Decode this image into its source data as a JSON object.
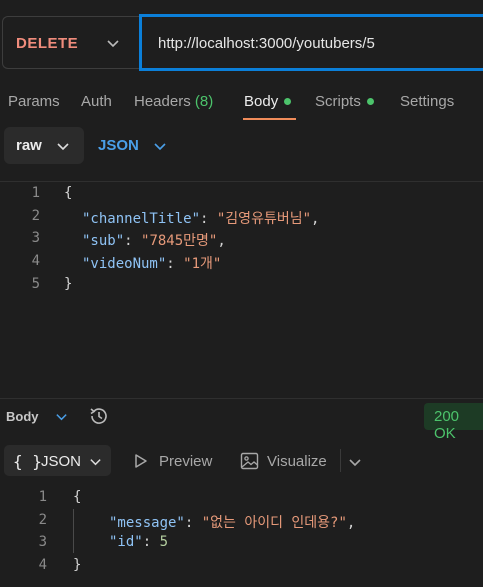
{
  "request": {
    "method": "DELETE",
    "url": "http://localhost:3000/youtubers/5"
  },
  "tabs": [
    {
      "label": "Params"
    },
    {
      "label": "Auth"
    },
    {
      "label": "Headers",
      "count": "(8)"
    },
    {
      "label": "Body",
      "active": true,
      "dot": true
    },
    {
      "label": "Scripts",
      "dot": true
    },
    {
      "label": "Settings"
    }
  ],
  "body_mode": {
    "mode": "raw",
    "format": "JSON"
  },
  "request_body": {
    "line_numbers": [
      "1",
      "2",
      "3",
      "4",
      "5"
    ],
    "open": "{",
    "close": "}",
    "fields": [
      {
        "key": "\"channelTitle\"",
        "value": "\"김영유튜버님\""
      },
      {
        "key": "\"sub\"",
        "value": "\"7845만명\""
      },
      {
        "key": "\"videoNum\"",
        "value": "\"1개\""
      }
    ]
  },
  "response": {
    "label": "Body",
    "status": "200 OK",
    "view": "JSON",
    "preview_label": "Preview",
    "visualize_label": "Visualize",
    "line_numbers": [
      "1",
      "2",
      "3",
      "4"
    ],
    "open": "{",
    "close": "}",
    "fields": [
      {
        "key": "\"message\"",
        "value": "\"없는 아이디 인데용?\""
      },
      {
        "key": "\"id\"",
        "value": "5"
      }
    ]
  },
  "icons": {
    "method_chevron": "chevron-down-icon",
    "history": "history-icon",
    "preview": "play-icon",
    "visualize": "image-icon"
  },
  "colors": {
    "method": "#f08c7c",
    "accent": "#0b7fd9",
    "active_underline": "#f08c5a",
    "success": "#4cc36b",
    "json_link": "#4a9fe8"
  }
}
